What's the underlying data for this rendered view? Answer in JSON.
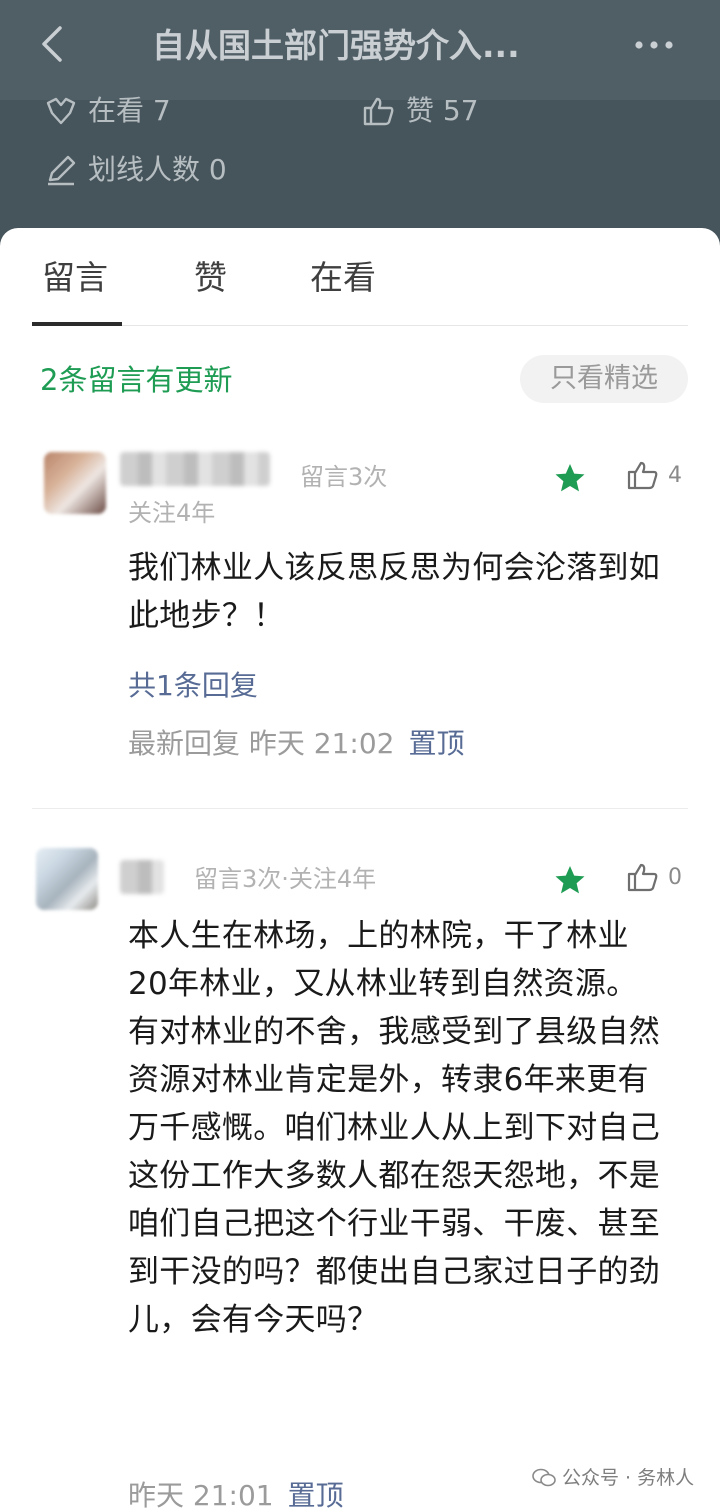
{
  "header": {
    "title": "自从国土部门强势介入...",
    "back_icon": "chevron-left-icon",
    "more_icon": "more-dots-icon"
  },
  "stats": {
    "watching": "在看 7",
    "likes": "赞 57",
    "underline": "划线人数 0"
  },
  "tabs": [
    {
      "label": "留言",
      "active": true
    },
    {
      "label": "赞",
      "active": false
    },
    {
      "label": "在看",
      "active": false
    }
  ],
  "update_notice": "2条留言有更新",
  "filter_button": "只看精选",
  "comments": [
    {
      "meta_count": "留言3次",
      "meta_follow": "关注4年",
      "featured": true,
      "like_count": "4",
      "text": "我们林业人该反思反思为何会沦落到如此地步？！",
      "reply_link": "共1条回复",
      "footer": "最新回复 昨天 21:02",
      "pin": "置顶"
    },
    {
      "meta": "留言3次·关注4年",
      "featured": true,
      "like_count": "0",
      "text": "本人生在林场，上的林院，干了林业20年林业，又从林业转到自然资源。有对林业的不舍，我感受到了县级自然资源对林业肯定是外，转隶6年来更有万千感慨。咱们林业人从上到下对自己这份工作大多数人都在怨天怨地，不是咱们自己把这个行业干弱、干废、甚至到干没的吗？都使出自己家过日子的劲儿，会有今天吗？",
      "footer": "昨天 21:01",
      "pin": "置顶"
    }
  ],
  "watermark": "公众号 · 务林人",
  "colors": {
    "accent_green": "#1f9c54",
    "link_blue": "#576b95",
    "header_bg": "#505e66"
  }
}
